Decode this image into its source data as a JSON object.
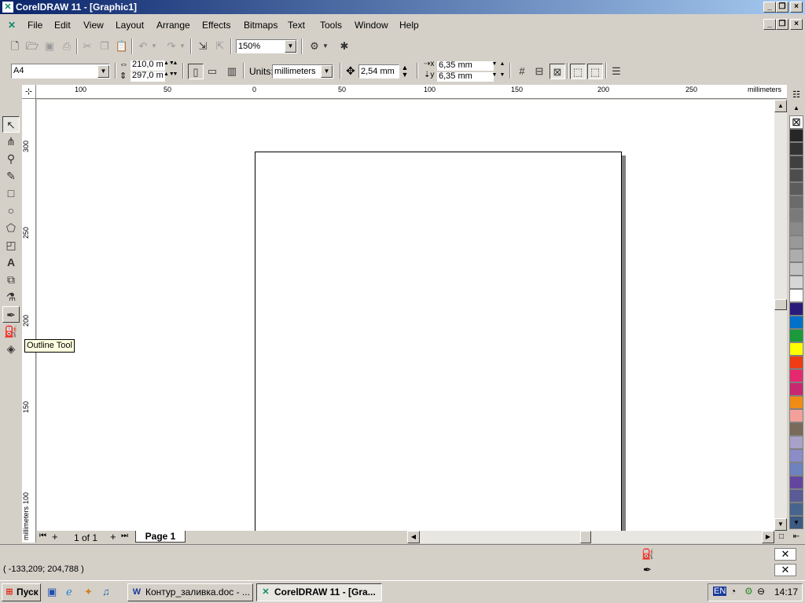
{
  "window": {
    "title": "CorelDRAW 11 - [Graphic1]",
    "min": "_",
    "restore": "❐",
    "close": "×"
  },
  "menu": [
    "File",
    "Edit",
    "View",
    "Layout",
    "Arrange",
    "Effects",
    "Bitmaps",
    "Text",
    "Tools",
    "Window",
    "Help"
  ],
  "toolbar": {
    "zoom": "150%"
  },
  "property_bar": {
    "paper_size": "A4",
    "width": "210,0 m",
    "height": "297,0 m",
    "units_label": "Units:",
    "units": "millimeters",
    "nudge": "2,54 mm",
    "dup_x": "6,35 mm",
    "dup_y": "6,35 mm"
  },
  "rulers": {
    "unit_label": "millimeters",
    "top_ticks": [
      "100",
      "50",
      "0",
      "50",
      "100",
      "150",
      "200",
      "250"
    ],
    "left_ticks": [
      "300",
      "250",
      "200",
      "150",
      "100"
    ]
  },
  "tooltip": "Outline Tool",
  "page_nav": {
    "counter": "1 of 1",
    "tab": "Page 1"
  },
  "status": {
    "coords": "( -133,209; 204,788 )"
  },
  "palette_colors": [
    "#262626",
    "#333333",
    "#404040",
    "#4d4d4d",
    "#5c5c5c",
    "#6b6b6b",
    "#7a7a7a",
    "#8a8a8a",
    "#999999",
    "#adadad",
    "#c2c2c2",
    "#d6d6d6",
    "#ffffff",
    "#2a1a7a",
    "#0070c8",
    "#1a9a3a",
    "#ffff00",
    "#f03c14",
    "#e6286e",
    "#c82870",
    "#f08c14",
    "#f4a09a",
    "#7a6a5a",
    "#a8a2c8",
    "#8c8cc8",
    "#6e82be",
    "#6446a0",
    "#5a5a96",
    "#46648c",
    "#3c5a82"
  ],
  "taskbar": {
    "start": "Пуск",
    "task1": "Контур_заливка.doc - ...",
    "task2": "CorelDRAW 11 - [Gra...",
    "lang": "EN",
    "clock": "14:17"
  }
}
